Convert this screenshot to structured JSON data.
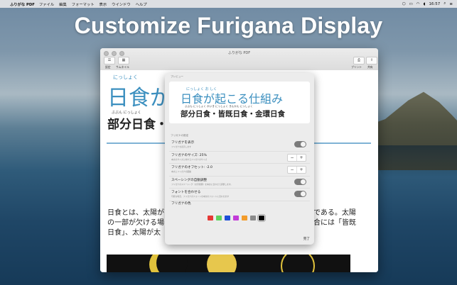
{
  "menubar": {
    "app_name": "ふりがな PDF",
    "items": [
      "ファイル",
      "編集",
      "フォーマット",
      "表示",
      "ウインドウ",
      "ヘルプ"
    ],
    "clock": "16:57"
  },
  "headline": "Customize Furigana Display",
  "window": {
    "title": "ふりがな PDF",
    "toolbar": {
      "settings_label": "設定",
      "thumbnail_label": "サムネイル",
      "print_label": "プリント",
      "share_label": "共有"
    }
  },
  "document": {
    "title": "日食が",
    "title_ruby": "にっしょく",
    "subtitle": "部分日食・",
    "subtitle_ruby": "ぶぶん にっしょく",
    "body_left": [
      "日食とは、太陽が",
      "の一部が欠ける場",
      "日食」、太陽が太"
    ],
    "body_right": [
      "である。太陽",
      "合には「皆既",
      ""
    ]
  },
  "sheet": {
    "preview_label": "プレビュー",
    "preview_title": "日食が起こる仕組み",
    "preview_title_ruby": "にっしょく          お          しく",
    "preview_sub": "部分日食・皆既日食・金環日食",
    "preview_sub_ruby": "ぶぶん にっしょく   かいき にっしょく   きんかん にっしょく",
    "section_label": "フリガナの設定",
    "rows": [
      {
        "label": "フリガナを表示",
        "desc": "フリガナを表示します",
        "control": "toggle"
      },
      {
        "label": "フリガナのサイズ: 25%",
        "desc": "本文のサイズに対するフリガナのサイズ",
        "control": "stepper"
      },
      {
        "label": "フリガナのオフセット: -2.0",
        "desc": "本文とフリガナの距離",
        "control": "stepper"
      },
      {
        "label": "スペーシングの自動調整",
        "desc": "フリガナのスペーシング（文字間隔）を本文に合わせて調整します。",
        "control": "toggle"
      },
      {
        "label": "フォントを合わせる",
        "desc": "可能な場合、フリガナのフォントを本文のフォントに合わせます",
        "control": "toggle"
      }
    ],
    "color_label": "フリガナの色",
    "colors": [
      "#e53935",
      "#5fd35f",
      "#1e4fd8",
      "#c23cd8",
      "#f39c2b",
      "#8a8a8a",
      "#000000"
    ],
    "selected_color": "#000000",
    "done_label": "完了",
    "stepper_minus": "−",
    "stepper_plus": "+"
  }
}
